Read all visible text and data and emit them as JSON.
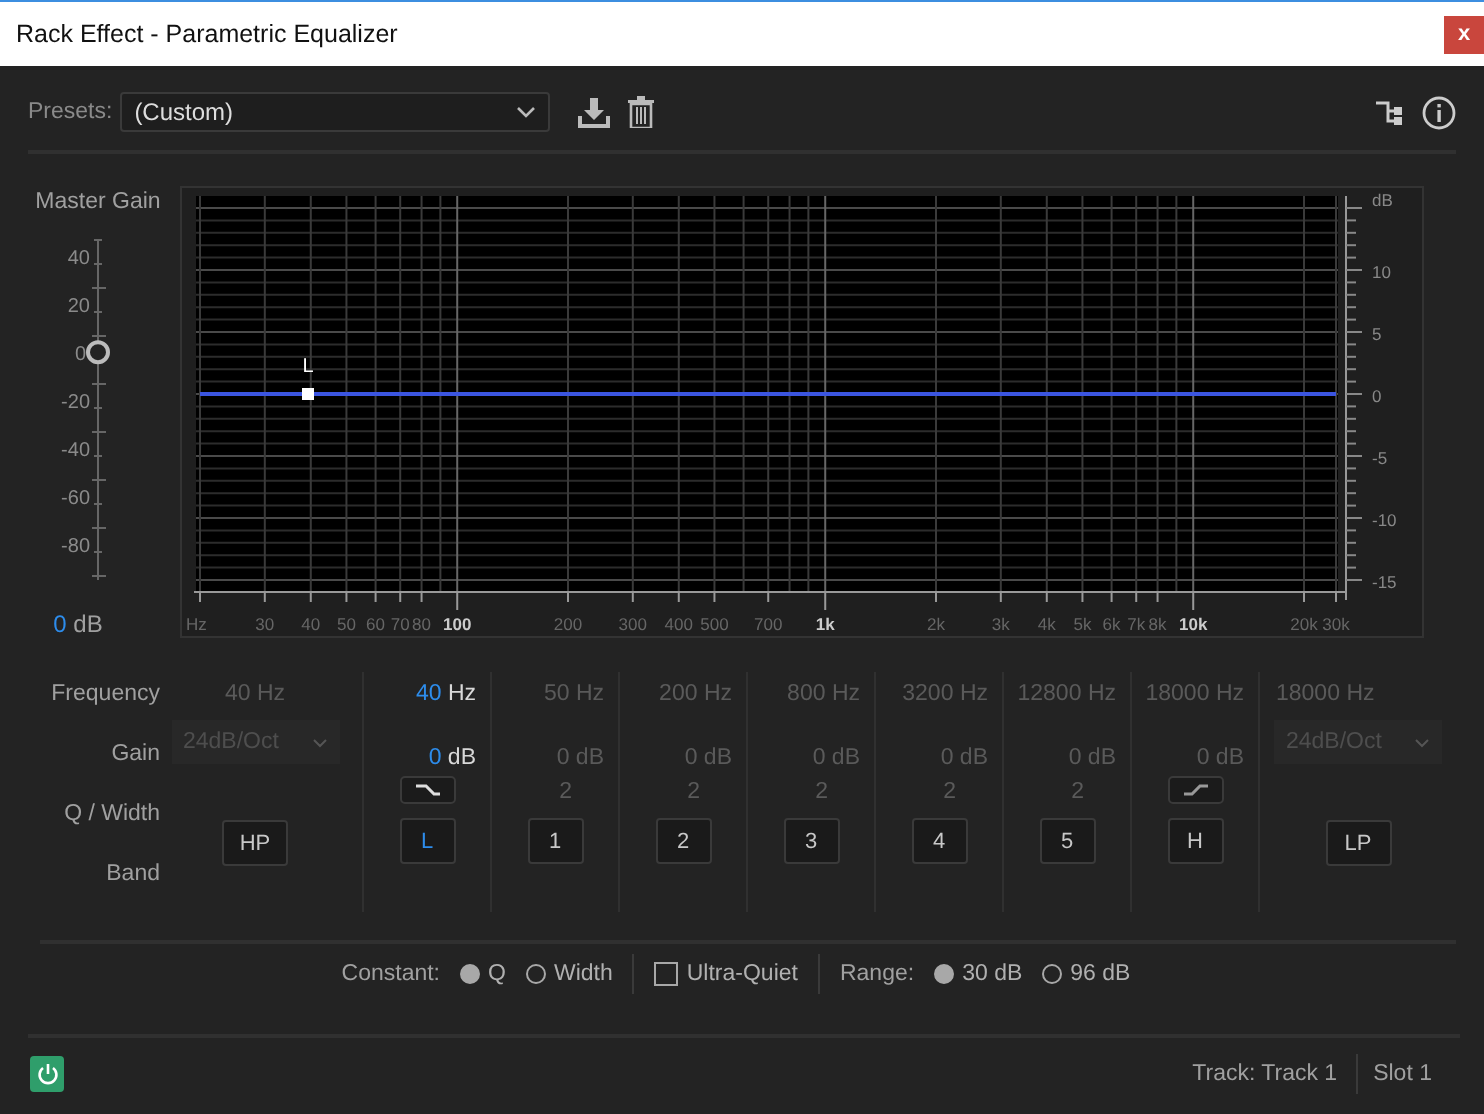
{
  "window": {
    "title": "Rack Effect - Parametric Equalizer",
    "close": "x"
  },
  "presets": {
    "label": "Presets:",
    "value": "(Custom)"
  },
  "master_gain": {
    "label": "Master Gain",
    "scale": [
      "40",
      "20",
      "0",
      "-20",
      "-40",
      "-60",
      "-80"
    ],
    "level": 0.67,
    "value": "0",
    "unit": "dB"
  },
  "graph": {
    "handle_label": "L",
    "x_labels": [
      {
        "text": "Hz",
        "major": false
      },
      {
        "text": "30",
        "major": false
      },
      {
        "text": "40",
        "major": false
      },
      {
        "text": "50",
        "major": false
      },
      {
        "text": "60",
        "major": false
      },
      {
        "text": "70",
        "major": false
      },
      {
        "text": "80",
        "major": false
      },
      {
        "text": "100",
        "major": true
      },
      {
        "text": "200",
        "major": false
      },
      {
        "text": "300",
        "major": false
      },
      {
        "text": "400",
        "major": false
      },
      {
        "text": "500",
        "major": false
      },
      {
        "text": "700",
        "major": false
      },
      {
        "text": "1k",
        "major": true
      },
      {
        "text": "2k",
        "major": false
      },
      {
        "text": "3k",
        "major": false
      },
      {
        "text": "4k",
        "major": false
      },
      {
        "text": "5k",
        "major": false
      },
      {
        "text": "6k",
        "major": false
      },
      {
        "text": "7k",
        "major": false
      },
      {
        "text": "8k",
        "major": false
      },
      {
        "text": "10k",
        "major": true
      },
      {
        "text": "20k",
        "major": false
      },
      {
        "text": "30k",
        "major": false
      }
    ],
    "y_labels": [
      "dB",
      "10",
      "5",
      "0",
      "-5",
      "-10",
      "-15"
    ]
  },
  "row_labels": [
    "Frequency",
    "Gain",
    "Q / Width",
    "Band"
  ],
  "bands": [
    {
      "kind": "highpass",
      "frequency": "40",
      "unit": "Hz",
      "slope": "24dB/Oct",
      "label": "HP",
      "on": false
    },
    {
      "kind": "low-shelf",
      "frequency": "40",
      "unit": "Hz",
      "gain": "0",
      "gain_unit": "dB",
      "label": "L",
      "on": true
    },
    {
      "kind": "peak",
      "frequency": "50",
      "unit": "Hz",
      "gain": "0",
      "gain_unit": "dB",
      "q": "2",
      "label": "1",
      "on": false
    },
    {
      "kind": "peak",
      "frequency": "200",
      "unit": "Hz",
      "gain": "0",
      "gain_unit": "dB",
      "q": "2",
      "label": "2",
      "on": false
    },
    {
      "kind": "peak",
      "frequency": "800",
      "unit": "Hz",
      "gain": "0",
      "gain_unit": "dB",
      "q": "2",
      "label": "3",
      "on": false
    },
    {
      "kind": "peak",
      "frequency": "3200",
      "unit": "Hz",
      "gain": "0",
      "gain_unit": "dB",
      "q": "2",
      "label": "4",
      "on": false
    },
    {
      "kind": "peak",
      "frequency": "12800",
      "unit": "Hz",
      "gain": "0",
      "gain_unit": "dB",
      "q": "2",
      "label": "5",
      "on": false
    },
    {
      "kind": "high-shelf",
      "frequency": "18000",
      "unit": "Hz",
      "gain": "0",
      "gain_unit": "dB",
      "label": "H",
      "on": false
    },
    {
      "kind": "lowpass",
      "frequency": "18000",
      "unit": "Hz",
      "slope": "24dB/Oct",
      "label": "LP",
      "on": false
    }
  ],
  "options": {
    "constant_label": "Constant:",
    "constant": [
      {
        "label": "Q",
        "selected": true
      },
      {
        "label": "Width",
        "selected": false
      }
    ],
    "ultra_quiet": {
      "label": "Ultra-Quiet",
      "checked": false
    },
    "range_label": "Range:",
    "range": [
      {
        "label": "30 dB",
        "selected": true
      },
      {
        "label": "96 dB",
        "selected": false
      }
    ]
  },
  "status": {
    "track": "Track: Track 1",
    "slot": "Slot 1",
    "power_on": true
  }
}
